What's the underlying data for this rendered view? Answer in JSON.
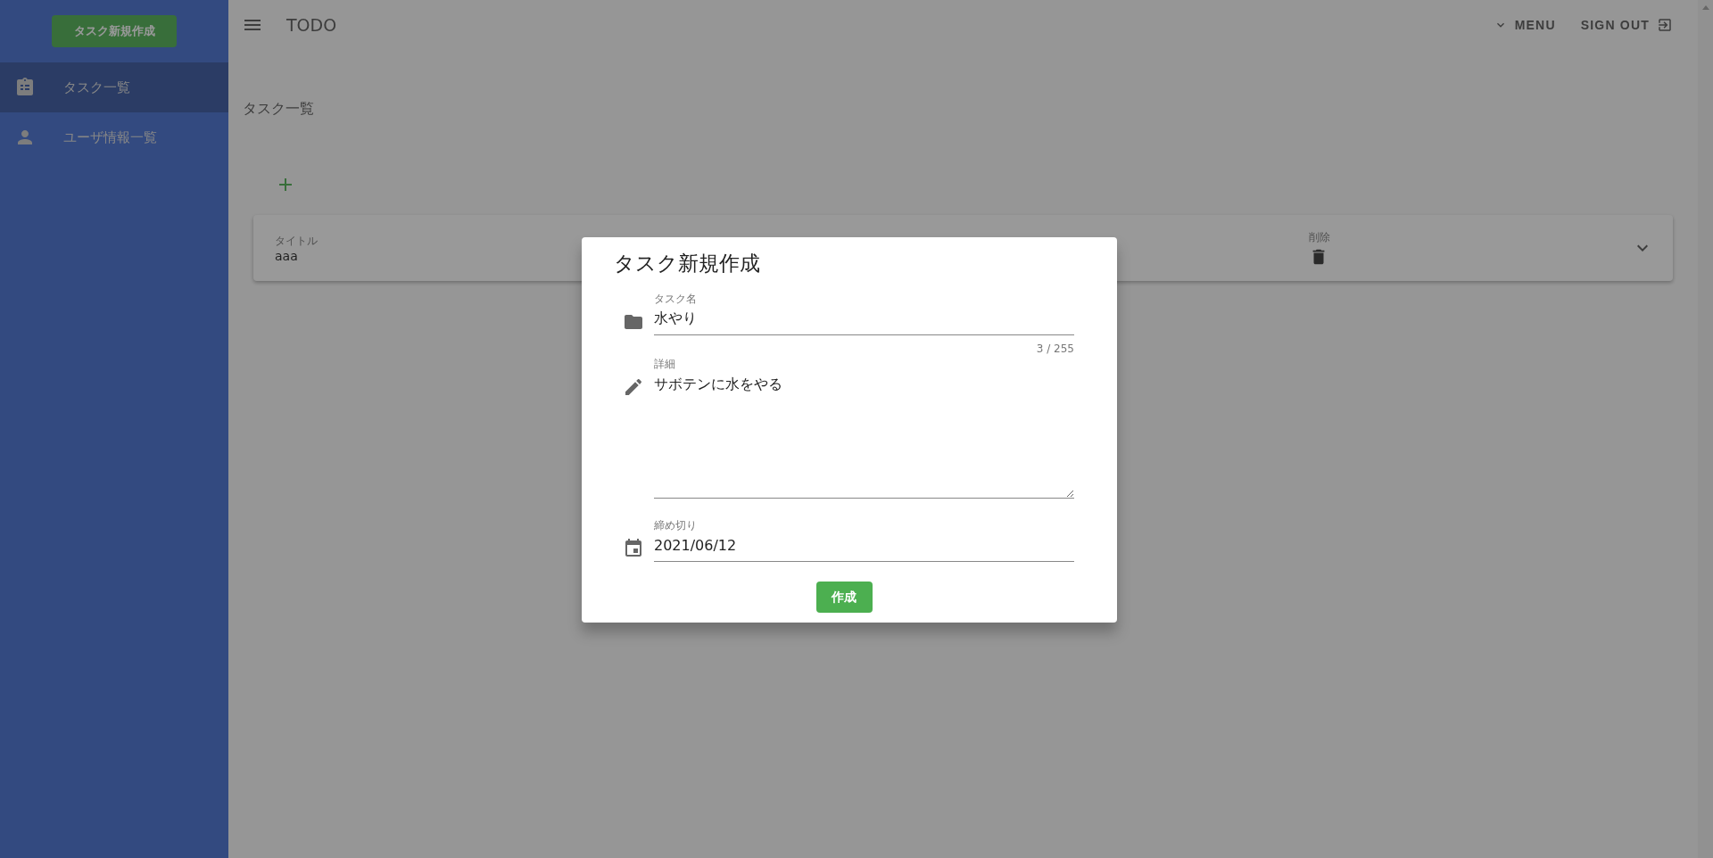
{
  "sidebar": {
    "create_button": "タスク新規作成",
    "items": [
      {
        "label": "タスク一覧",
        "selected": true
      },
      {
        "label": "ユーザ情報一覧",
        "selected": false
      }
    ]
  },
  "app_bar": {
    "title": "TODO",
    "menu": "MENU",
    "sign_out": "SIGN OUT"
  },
  "page_title": "タスク一覧",
  "task_card": {
    "title_header": "タイトル",
    "title_value": "aaa",
    "delete_header": "削除"
  },
  "dialog": {
    "title": "タスク新規作成",
    "fields": [
      {
        "kind": "text",
        "label": "タスク名",
        "value": "水やり",
        "counter": "3 / 255"
      },
      {
        "kind": "textarea",
        "label": "詳細",
        "value": "サボテンに水をやる"
      },
      {
        "kind": "text",
        "label": "締め切り",
        "value": "2021/06/12"
      }
    ],
    "submit": "作成"
  }
}
